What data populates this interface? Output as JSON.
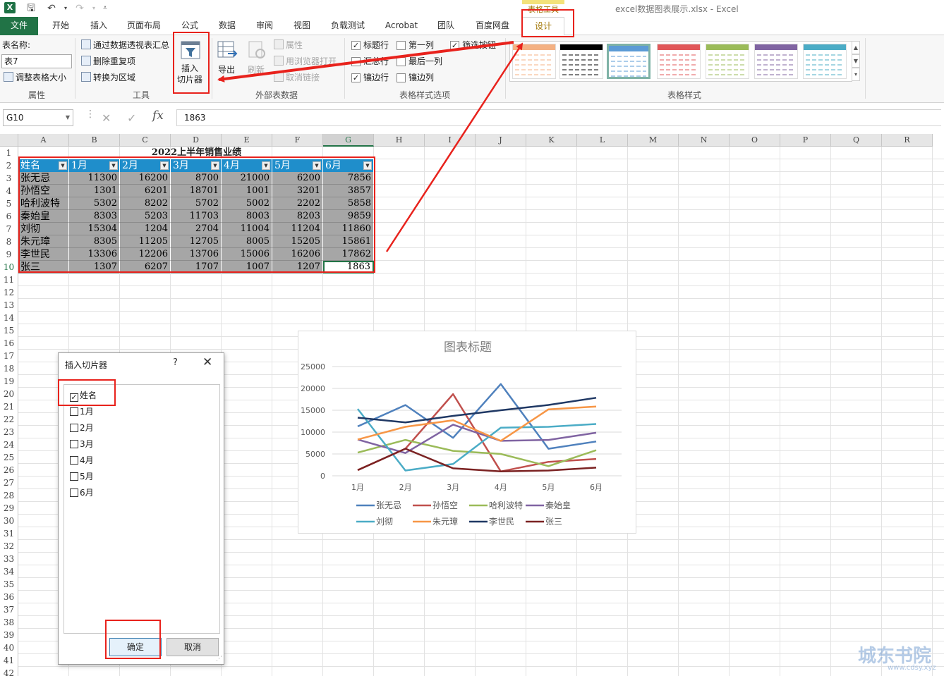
{
  "window": {
    "file_title": "excel数据图表展示.xlsx - Excel",
    "context_tab_group": "表格工具",
    "app_icon": "excel-logo-icon"
  },
  "tabs": [
    {
      "label": "文件"
    },
    {
      "label": "开始"
    },
    {
      "label": "插入"
    },
    {
      "label": "页面布局"
    },
    {
      "label": "公式"
    },
    {
      "label": "数据"
    },
    {
      "label": "审阅"
    },
    {
      "label": "视图"
    },
    {
      "label": "负载测试"
    },
    {
      "label": "Acrobat"
    },
    {
      "label": "团队"
    },
    {
      "label": "百度网盘"
    },
    {
      "label": "设计"
    }
  ],
  "ribbon": {
    "properties": {
      "table_name_label": "表名称:",
      "table_name_value": "表7",
      "resize_label": "调整表格大小",
      "group_label": "属性"
    },
    "tools": {
      "pivot_label": "通过数据透视表汇总",
      "remove_dup_label": "删除重复项",
      "convert_label": "转换为区域",
      "slicer_label_line1": "插入",
      "slicer_label_line2": "切片器",
      "group_label": "工具"
    },
    "external": {
      "export_label": "导出",
      "refresh_label": "刷新",
      "props_label": "属性",
      "browser_label": "用浏览器打开",
      "unlink_label": "取消链接",
      "group_label": "外部表数据"
    },
    "style_options": {
      "header_row": "标题行",
      "total_row": "汇总行",
      "banded_rows": "镶边行",
      "first_col": "第一列",
      "last_col": "最后一列",
      "banded_cols": "镶边列",
      "filter_btn": "筛选按钮",
      "checked": "✓",
      "group_label": "表格样式选项"
    },
    "styles": {
      "group_label": "表格样式",
      "swatch_colors": [
        "#f4b183",
        "#000000",
        "#5b9bd5",
        "#e15759",
        "#9bbb59",
        "#8064a2",
        "#4bacc6"
      ],
      "scroll_up": "▲",
      "scroll_down": "▼",
      "more": "▾"
    }
  },
  "formula_bar": {
    "name_box": "G10",
    "cancel": "✕",
    "enter": "✓",
    "fx": "fx",
    "value": "1863"
  },
  "sheet": {
    "columns": [
      "A",
      "B",
      "C",
      "D",
      "E",
      "F",
      "G",
      "H",
      "I",
      "J",
      "K",
      "L",
      "M",
      "N",
      "O",
      "P",
      "Q",
      "R"
    ],
    "rows": [
      "1",
      "2",
      "3",
      "4",
      "5",
      "6",
      "7",
      "8",
      "9",
      "10",
      "11",
      "12",
      "13",
      "14",
      "15",
      "16",
      "17",
      "18",
      "19",
      "20",
      "21",
      "22",
      "23",
      "24",
      "25",
      "26",
      "27",
      "28",
      "29",
      "30",
      "31",
      "32",
      "33",
      "34",
      "35",
      "36",
      "37",
      "38",
      "39",
      "40",
      "41",
      "42"
    ],
    "title": "2022上半年销售业绩",
    "headers": [
      "姓名",
      "1月",
      "2月",
      "3月",
      "4月",
      "5月",
      "6月"
    ],
    "dropdown": "▼",
    "data": [
      [
        "张无忌",
        "11300",
        "16200",
        "8700",
        "21000",
        "6200",
        "7856"
      ],
      [
        "孙悟空",
        "1301",
        "6201",
        "18701",
        "1001",
        "3201",
        "3857"
      ],
      [
        "哈利波特",
        "5302",
        "8202",
        "5702",
        "5002",
        "2202",
        "5858"
      ],
      [
        "秦始皇",
        "8303",
        "5203",
        "11703",
        "8003",
        "8203",
        "9859"
      ],
      [
        "刘彻",
        "15304",
        "1204",
        "2704",
        "11004",
        "11204",
        "11860"
      ],
      [
        "朱元璋",
        "8305",
        "11205",
        "12705",
        "8005",
        "15205",
        "15861"
      ],
      [
        "李世民",
        "13306",
        "12206",
        "13706",
        "15006",
        "16206",
        "17862"
      ],
      [
        "张三",
        "1307",
        "6207",
        "1707",
        "1007",
        "1207",
        "1863"
      ]
    ]
  },
  "chart_data": {
    "type": "line",
    "title": "图表标题",
    "categories": [
      "1月",
      "2月",
      "3月",
      "4月",
      "5月",
      "6月"
    ],
    "ylim": [
      0,
      25000
    ],
    "yticks": [
      "25000",
      "20000",
      "15000",
      "10000",
      "5000",
      "0"
    ],
    "grid": true,
    "legend_position": "bottom",
    "series": [
      {
        "name": "张无忌",
        "color": "#4f81bd",
        "values": [
          11300,
          16200,
          8700,
          21000,
          6200,
          7856
        ]
      },
      {
        "name": "孙悟空",
        "color": "#c0504d",
        "values": [
          1301,
          6201,
          18701,
          1001,
          3201,
          3857
        ]
      },
      {
        "name": "哈利波特",
        "color": "#9bbb59",
        "values": [
          5302,
          8202,
          5702,
          5002,
          2202,
          5858
        ]
      },
      {
        "name": "秦始皇",
        "color": "#8064a2",
        "values": [
          8303,
          5203,
          11703,
          8003,
          8203,
          9859
        ]
      },
      {
        "name": "刘彻",
        "color": "#4bacc6",
        "values": [
          15304,
          1204,
          2704,
          11004,
          11204,
          11860
        ]
      },
      {
        "name": "朱元璋",
        "color": "#f79646",
        "values": [
          8305,
          11205,
          12705,
          8005,
          15205,
          15861
        ]
      },
      {
        "name": "李世民",
        "color": "#1f3864",
        "values": [
          13306,
          12206,
          13706,
          15006,
          16206,
          17862
        ]
      },
      {
        "name": "张三",
        "color": "#7b2222",
        "values": [
          1307,
          6207,
          1707,
          1007,
          1207,
          1863
        ]
      }
    ]
  },
  "dialog": {
    "title": "插入切片器",
    "help": "?",
    "close": "✕",
    "items": [
      {
        "label": "姓名",
        "checked": true
      },
      {
        "label": "1月",
        "checked": false
      },
      {
        "label": "2月",
        "checked": false
      },
      {
        "label": "3月",
        "checked": false
      },
      {
        "label": "4月",
        "checked": false
      },
      {
        "label": "5月",
        "checked": false
      },
      {
        "label": "6月",
        "checked": false
      }
    ],
    "check_mark": "✓",
    "ok_label": "确定",
    "cancel_label": "取消",
    "grip": "⋰"
  },
  "annotation_color": "#e8221c",
  "watermark": {
    "text": "城东书院",
    "sub": "www.cdsy.xyz"
  }
}
